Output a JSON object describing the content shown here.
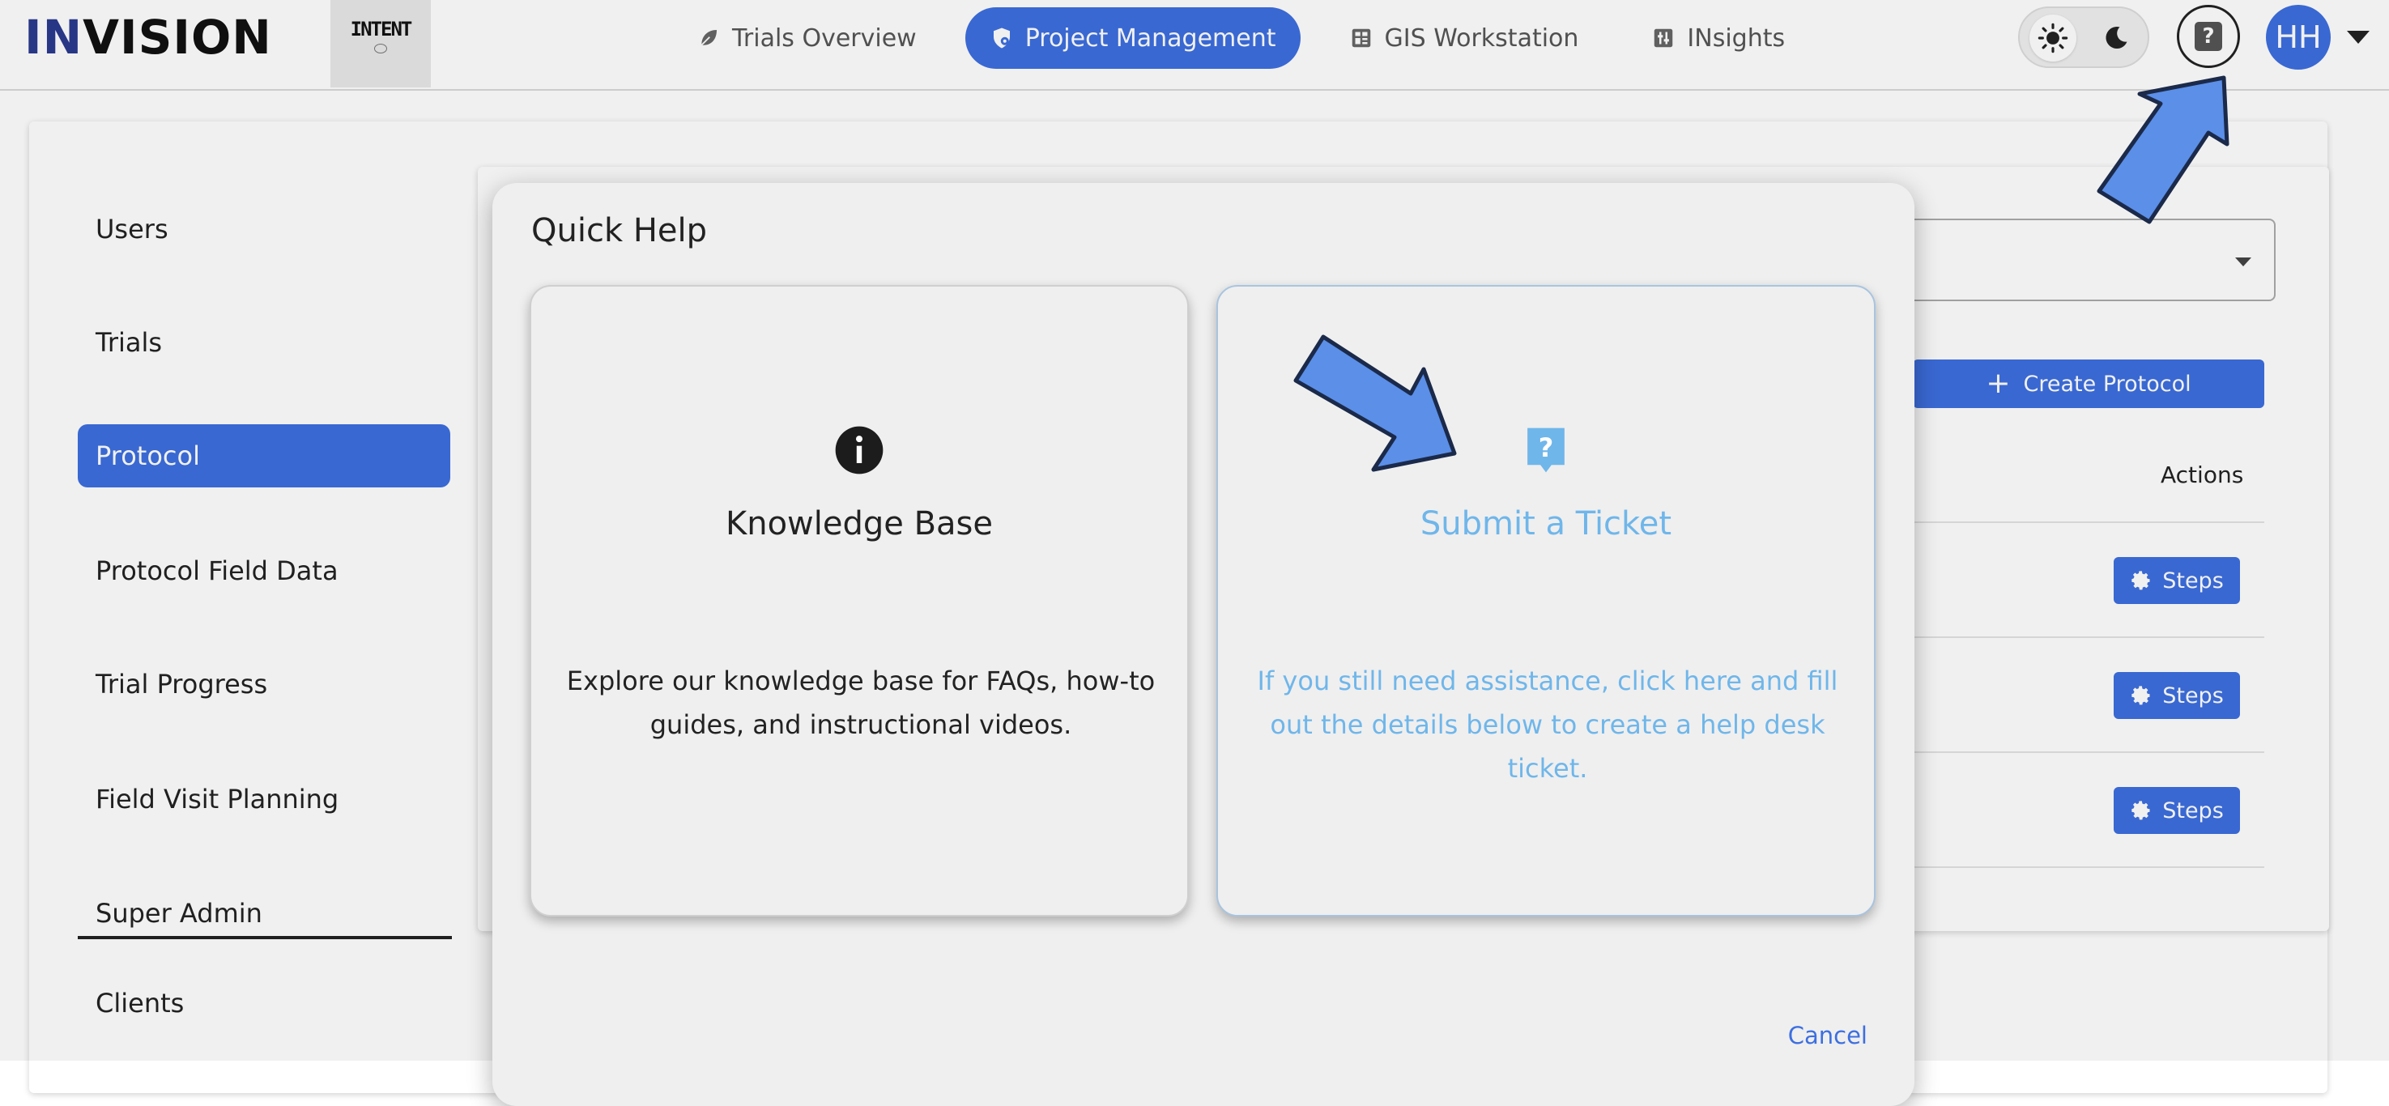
{
  "header": {
    "brand_prefix": "IN",
    "brand_suffix": "VISION",
    "client_logo_text": "INTENT",
    "nav": [
      {
        "label": "Trials Overview",
        "icon": "leaf-icon"
      },
      {
        "label": "Project Management",
        "icon": "shield-gear-icon",
        "active": true
      },
      {
        "label": "GIS Workstation",
        "icon": "grid-icon"
      },
      {
        "label": "INsights",
        "icon": "sliders-icon"
      }
    ],
    "avatar_initials": "HH",
    "help_glyph": "?"
  },
  "sidebar": {
    "items": [
      {
        "label": "Users"
      },
      {
        "label": "Trials"
      },
      {
        "label": "Protocol",
        "active": true
      },
      {
        "label": "Protocol Field Data"
      },
      {
        "label": "Trial Progress"
      },
      {
        "label": "Field Visit Planning"
      }
    ],
    "section_label": "Super Admin",
    "section_items": [
      {
        "label": "Clients"
      }
    ]
  },
  "main": {
    "create_button": "Create Protocol",
    "actions_header": "Actions",
    "steps_label": "Steps"
  },
  "dialog": {
    "title": "Quick Help",
    "knowledge_base": {
      "title": "Knowledge Base",
      "description": "Explore our knowledge base for FAQs, how-to guides, and instructional videos."
    },
    "submit_ticket": {
      "title": "Submit a Ticket",
      "description": "If you still need assistance, click here and fill out the details below to create a help desk ticket."
    },
    "cancel_label": "Cancel"
  },
  "colors": {
    "accent": "#3d6fe0",
    "ticket_text": "#6fb6ea",
    "annotation_arrow": "#5b8fe8"
  }
}
